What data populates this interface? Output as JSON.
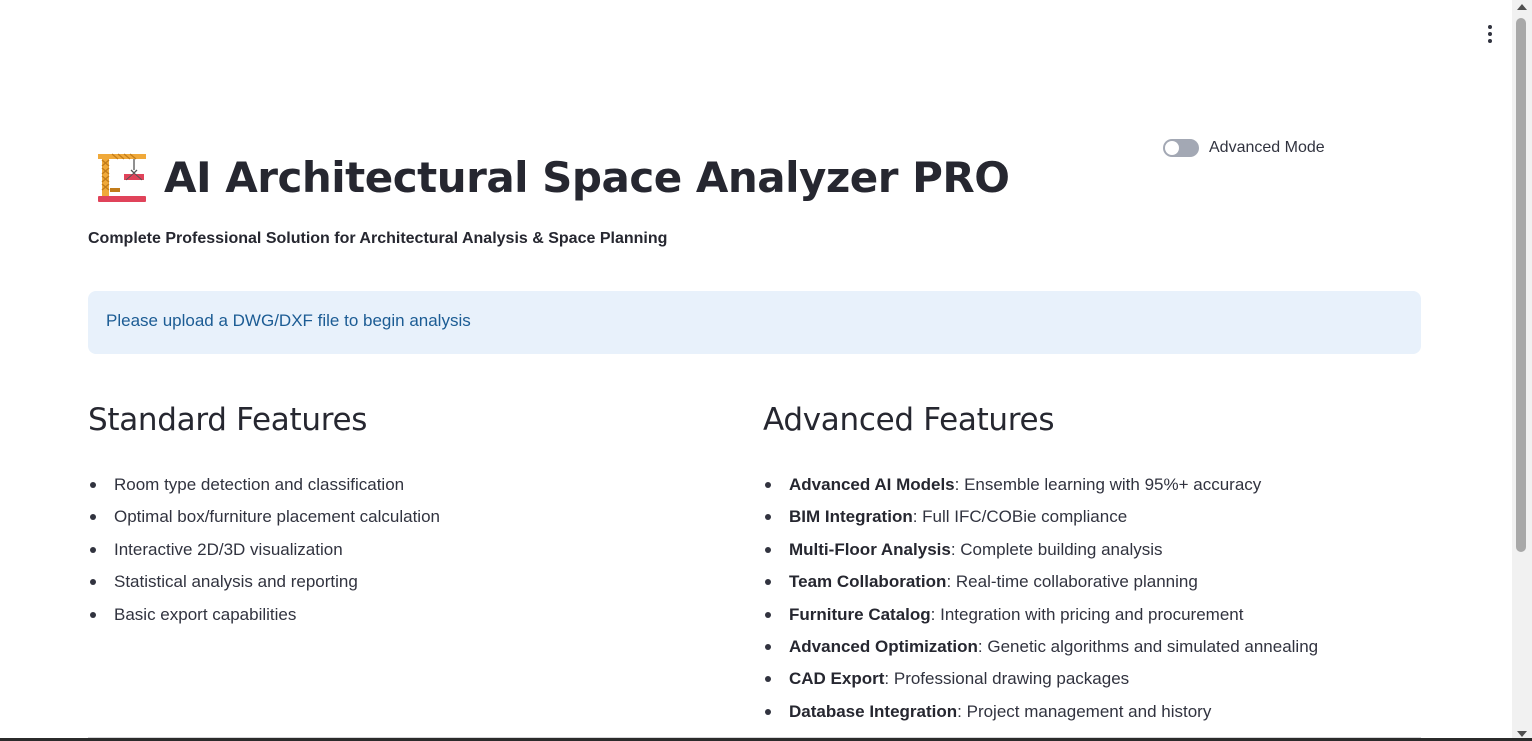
{
  "header": {
    "title": "AI Architectural Space Analyzer PRO",
    "subtitle": "Complete Professional Solution for Architectural Analysis & Space Planning",
    "icon": "crane-icon",
    "menu_icon": "vertical-ellipsis-icon"
  },
  "toggle": {
    "label": "Advanced Mode",
    "checked": false
  },
  "info": {
    "message": "Please upload a DWG/DXF file to begin analysis"
  },
  "standard": {
    "heading": "Standard Features",
    "items": [
      "Room type detection and classification",
      "Optimal box/furniture placement calculation",
      "Interactive 2D/3D visualization",
      "Statistical analysis and reporting",
      "Basic export capabilities"
    ]
  },
  "advanced": {
    "heading": "Advanced Features",
    "items": [
      {
        "name": "Advanced AI Models",
        "desc": ": Ensemble learning with 95%+ accuracy"
      },
      {
        "name": "BIM Integration",
        "desc": ": Full IFC/COBie compliance"
      },
      {
        "name": "Multi-Floor Analysis",
        "desc": ": Complete building analysis"
      },
      {
        "name": "Team Collaboration",
        "desc": ": Real-time collaborative planning"
      },
      {
        "name": "Furniture Catalog",
        "desc": ": Integration with pricing and procurement"
      },
      {
        "name": "Advanced Optimization",
        "desc": ": Genetic algorithms and simulated annealing"
      },
      {
        "name": "CAD Export",
        "desc": ": Professional drawing packages"
      },
      {
        "name": "Database Integration",
        "desc": ": Project management and history"
      }
    ]
  },
  "colors": {
    "info_bg": "#e8f1fb",
    "info_text": "#1c5c94",
    "text": "#31333f"
  }
}
